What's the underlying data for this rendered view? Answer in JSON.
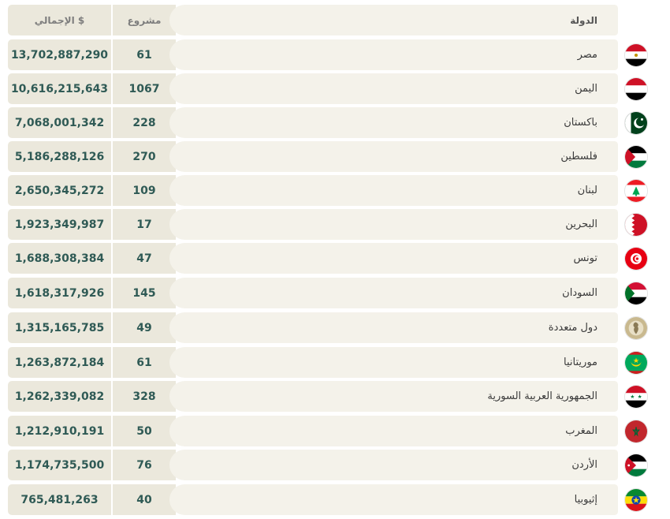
{
  "header": {
    "total_label": "الإجمالي $",
    "projects_label": "مشروع",
    "country_label": "الدولة"
  },
  "rows": [
    {
      "country": "مصر",
      "projects": "61",
      "total": "13,702,887,290",
      "flag_icon": "egypt-flag-icon"
    },
    {
      "country": "اليمن",
      "projects": "1067",
      "total": "10,616,215,643",
      "flag_icon": "yemen-flag-icon"
    },
    {
      "country": "باكستان",
      "projects": "228",
      "total": "7,068,001,342",
      "flag_icon": "pakistan-flag-icon"
    },
    {
      "country": "فلسطين",
      "projects": "270",
      "total": "5,186,288,126",
      "flag_icon": "palestine-flag-icon"
    },
    {
      "country": "لبنان",
      "projects": "109",
      "total": "2,650,345,272",
      "flag_icon": "lebanon-flag-icon"
    },
    {
      "country": "البحرين",
      "projects": "17",
      "total": "1,923,349,987",
      "flag_icon": "bahrain-flag-icon"
    },
    {
      "country": "تونس",
      "projects": "47",
      "total": "1,688,308,384",
      "flag_icon": "tunisia-flag-icon"
    },
    {
      "country": "السودان",
      "projects": "145",
      "total": "1,618,317,926",
      "flag_icon": "sudan-flag-icon"
    },
    {
      "country": "دول متعددة",
      "projects": "49",
      "total": "1,315,165,785",
      "flag_icon": "multiple-countries-icon"
    },
    {
      "country": "موريتانيا",
      "projects": "61",
      "total": "1,263,872,184",
      "flag_icon": "mauritania-flag-icon"
    },
    {
      "country": "الجمهورية العربية السورية",
      "projects": "328",
      "total": "1,262,339,082",
      "flag_icon": "syria-flag-icon"
    },
    {
      "country": "المغرب",
      "projects": "50",
      "total": "1,212,910,191",
      "flag_icon": "morocco-flag-icon"
    },
    {
      "country": "الأردن",
      "projects": "76",
      "total": "1,174,735,500",
      "flag_icon": "jordan-flag-icon"
    },
    {
      "country": "إثيوبيا",
      "projects": "40",
      "total": "765,481,263",
      "flag_icon": "ethiopia-flag-icon"
    }
  ],
  "colors": {
    "accent": "#2f5a55",
    "cell_dark": "#ebe8dc",
    "cell_light": "#f4f2ea"
  }
}
